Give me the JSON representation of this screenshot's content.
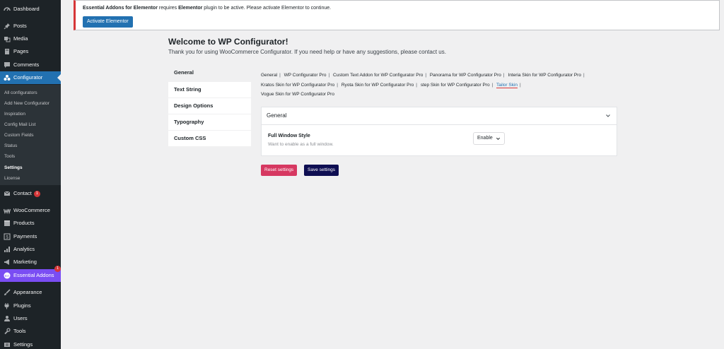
{
  "sidebar": {
    "items": [
      {
        "label": "Dashboard",
        "icon": "dashboard-icon"
      },
      {
        "label": "Posts",
        "icon": "pin-icon"
      },
      {
        "label": "Media",
        "icon": "media-icon"
      },
      {
        "label": "Pages",
        "icon": "pages-icon"
      },
      {
        "label": "Comments",
        "icon": "comment-icon"
      },
      {
        "label": "Configurator",
        "icon": "configurator-icon"
      },
      {
        "label": "Contact",
        "icon": "mail-icon",
        "badge": "1"
      },
      {
        "label": "WooCommerce",
        "icon": "woo-icon"
      },
      {
        "label": "Products",
        "icon": "products-icon"
      },
      {
        "label": "Payments",
        "icon": "payments-icon"
      },
      {
        "label": "Analytics",
        "icon": "analytics-icon"
      },
      {
        "label": "Marketing",
        "icon": "megaphone-icon"
      },
      {
        "label": "Essential Addons",
        "icon": "ea-icon",
        "badge": "1"
      },
      {
        "label": "Appearance",
        "icon": "brush-icon"
      },
      {
        "label": "Plugins",
        "icon": "plugin-icon"
      },
      {
        "label": "Users",
        "icon": "user-icon"
      },
      {
        "label": "Tools",
        "icon": "wrench-icon"
      },
      {
        "label": "Settings",
        "icon": "settings-icon"
      }
    ],
    "submenu": [
      "All configurators",
      "Add New Configurator",
      "Inspiration",
      "Config Mail List",
      "Custom Fields",
      "Status",
      "Tools",
      "Settings",
      "License"
    ]
  },
  "notice": {
    "plugin": "Essential Addons for Elementor",
    "text_mid": " requires ",
    "dependency": "Elementor",
    "text_end": " plugin to be active. Please activate Elementor to continue.",
    "button": "Activate Elementor"
  },
  "header": {
    "title": "Welcome to WP Configurator!",
    "subtitle": "Thank you for using WooCommerce Configurator. If you need help or have any suggestions, please contact us."
  },
  "tabs": [
    "General",
    "Text String",
    "Design Options",
    "Typography",
    "Custom CSS"
  ],
  "links": [
    "General",
    "WP Configurator Pro",
    "Custom Text Addon for WP Configurator Pro",
    "Panorama for WP Configurator Pro",
    "Interia Skin for WP Configurator Pro",
    "Kratos Skin for WP Configurator Pro",
    "Ryota Skin for WP Configurator Pro",
    "step Skin for WP Configurator Pro",
    "Tailor Skin",
    "Vogue Skin for WP Configurator Pro"
  ],
  "panel": {
    "title": "General",
    "field_label": "Full Window Style",
    "field_desc": "Want to enable as a full window.",
    "field_value": "Enable"
  },
  "buttons": {
    "reset": "Reset settings",
    "save": "Save settings"
  },
  "colors": {
    "sidebar_bg": "#1d2327",
    "accent": "#2271b1",
    "alert": "#d63638",
    "ea_purple": "#7a4df3",
    "reset": "#d63861",
    "save": "#0e0e52"
  }
}
